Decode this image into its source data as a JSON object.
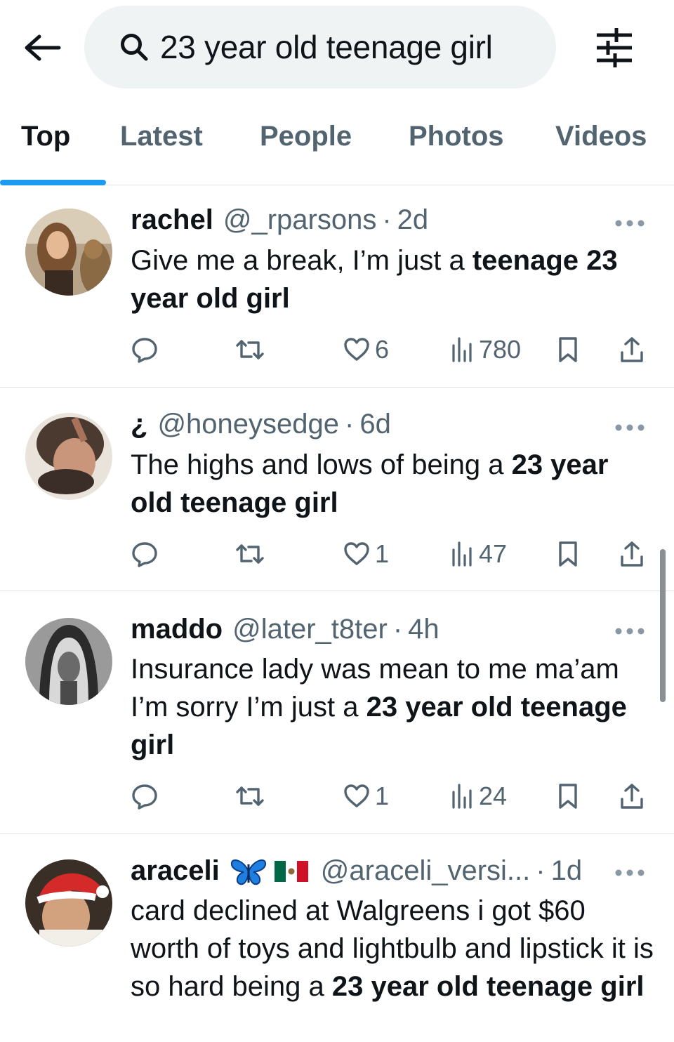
{
  "header": {
    "search_query": "23 year old teenage girl"
  },
  "tabs": [
    {
      "label": "Top",
      "active": true
    },
    {
      "label": "Latest",
      "active": false
    },
    {
      "label": "People",
      "active": false
    },
    {
      "label": "Photos",
      "active": false
    },
    {
      "label": "Videos",
      "active": false
    }
  ],
  "posts": [
    {
      "name": "rachel",
      "handle": "@_rparsons",
      "dot": "·",
      "time": "2d",
      "body": [
        {
          "text": "Give me a break, I’m just a ",
          "bold": false
        },
        {
          "text": "teenage 23 year old girl",
          "bold": true
        }
      ],
      "likes": "6",
      "views": "780"
    },
    {
      "name": "¿",
      "handle": "@honeysedge",
      "dot": "·",
      "time": "6d",
      "body": [
        {
          "text": "The highs and lows of being a ",
          "bold": false
        },
        {
          "text": "23 year old teenage girl",
          "bold": true
        }
      ],
      "likes": "1",
      "views": "47"
    },
    {
      "name": "maddo",
      "handle": "@later_t8ter",
      "dot": "·",
      "time": "4h",
      "body": [
        {
          "text": "Insurance lady was mean to me ma’am I’m sorry I’m just a ",
          "bold": false
        },
        {
          "text": "23 year old teenage girl",
          "bold": true
        }
      ],
      "likes": "1",
      "views": "24"
    },
    {
      "name": "araceli",
      "handle": "@araceli_versi...",
      "dot": "·",
      "time": "1d",
      "body": [
        {
          "text": "card declined at Walgreens i got $60 worth of toys and lightbulb and lipstick it is so hard being a ",
          "bold": false
        },
        {
          "text": "23 year old teenage girl",
          "bold": true
        }
      ],
      "name_icons": [
        "butterfly-icon",
        "mexico-flag-icon"
      ]
    }
  ],
  "colors": {
    "accent": "#1d9bf0",
    "text_primary": "#0f1419",
    "text_secondary": "#536471",
    "search_bg": "#eff3f4",
    "divider": "#dfe3e6"
  }
}
